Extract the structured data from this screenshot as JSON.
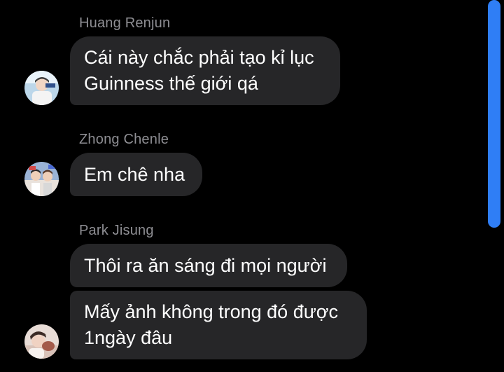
{
  "messages": [
    {
      "sender": "Huang Renjun",
      "bubbles": [
        {
          "lines": [
            "Cái này chắc phải tạo kỉ lục",
            "Guinness thế giới qá"
          ]
        }
      ]
    },
    {
      "sender": "Zhong Chenle",
      "bubbles": [
        {
          "lines": [
            "Em chê nha"
          ]
        }
      ]
    },
    {
      "sender": "Park Jisung",
      "bubbles": [
        {
          "lines": [
            "Thôi ra ăn sáng đi mọi người"
          ]
        },
        {
          "lines": [
            "Mấy ảnh không trong đó được",
            "1ngày đâu"
          ]
        }
      ]
    }
  ],
  "colors": {
    "background": "#000000",
    "bubble": "#262628",
    "sender_name": "#8e8e93",
    "scrollbar": "#2f7ef6"
  }
}
